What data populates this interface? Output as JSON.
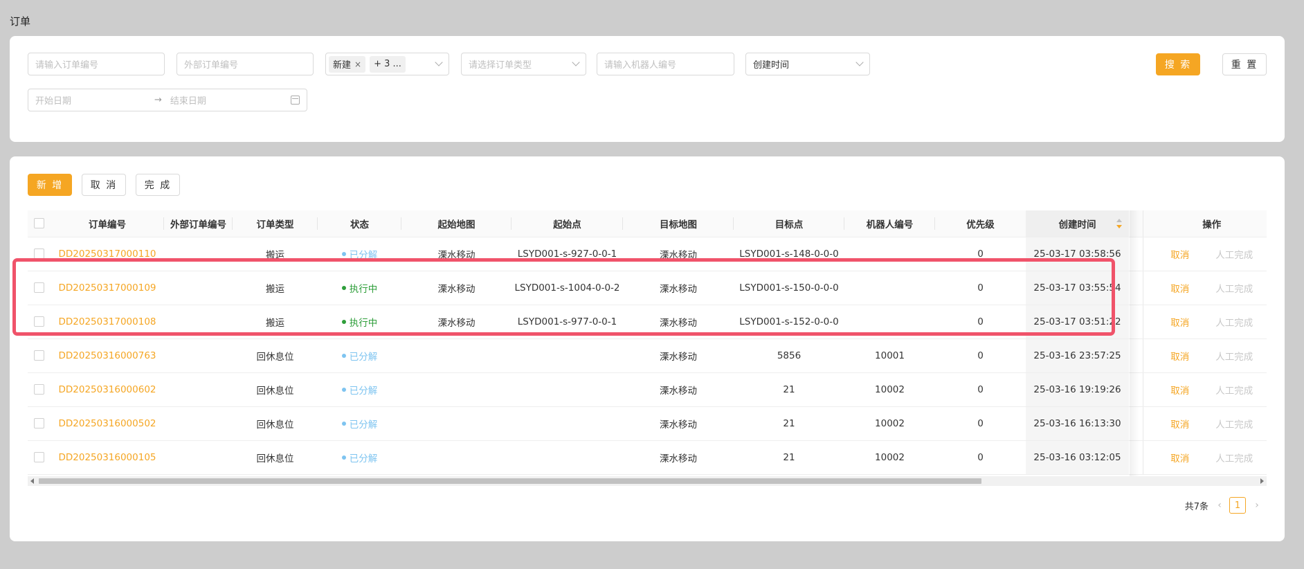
{
  "page": {
    "title": "订单"
  },
  "filters": {
    "order_no_placeholder": "请输入订单编号",
    "external_no_placeholder": "外部订单编号",
    "status_tags": [
      "新建",
      "+ 3 ..."
    ],
    "order_type_placeholder": "请选择订单类型",
    "robot_no_placeholder": "请输入机器人编号",
    "sort_field_value": "创建时间",
    "start_date_placeholder": "开始日期",
    "date_separator": "→",
    "end_date_placeholder": "结束日期",
    "search_label": "搜 索",
    "reset_label": "重 置"
  },
  "toolbar": {
    "add_label": "新 增",
    "cancel_label": "取 消",
    "complete_label": "完 成"
  },
  "table": {
    "columns": [
      "订单编号",
      "外部订单编号",
      "订单类型",
      "状态",
      "起始地图",
      "起始点",
      "目标地图",
      "目标点",
      "机器人编号",
      "优先级",
      "创建时间",
      "操作"
    ],
    "rows": [
      {
        "order_no": "DD20250317000110",
        "external_no": "",
        "type": "搬运",
        "status": "已分解",
        "start_map": "溧水移动",
        "start_point": "LSYD001-s-927-0-0-1",
        "target_map": "溧水移动",
        "target_point": "LSYD001-s-148-0-0-0",
        "robot_no": "",
        "priority": "0",
        "created": "25-03-17 03:58:56",
        "act_cancel": "取消",
        "act_done": "人工完成"
      },
      {
        "order_no": "DD20250317000109",
        "external_no": "",
        "type": "搬运",
        "status": "执行中",
        "start_map": "溧水移动",
        "start_point": "LSYD001-s-1004-0-0-2",
        "target_map": "溧水移动",
        "target_point": "LSYD001-s-150-0-0-0",
        "robot_no": "",
        "priority": "0",
        "created": "25-03-17 03:55:54",
        "act_cancel": "取消",
        "act_done": "人工完成"
      },
      {
        "order_no": "DD20250317000108",
        "external_no": "",
        "type": "搬运",
        "status": "执行中",
        "start_map": "溧水移动",
        "start_point": "LSYD001-s-977-0-0-1",
        "target_map": "溧水移动",
        "target_point": "LSYD001-s-152-0-0-0",
        "robot_no": "",
        "priority": "0",
        "created": "25-03-17 03:51:22",
        "act_cancel": "取消",
        "act_done": "人工完成"
      },
      {
        "order_no": "DD20250316000763",
        "external_no": "",
        "type": "回休息位",
        "status": "已分解",
        "start_map": "",
        "start_point": "",
        "target_map": "溧水移动",
        "target_point": "5856",
        "robot_no": "10001",
        "priority": "0",
        "created": "25-03-16 23:57:25",
        "act_cancel": "取消",
        "act_done": "人工完成"
      },
      {
        "order_no": "DD20250316000602",
        "external_no": "",
        "type": "回休息位",
        "status": "已分解",
        "start_map": "",
        "start_point": "",
        "target_map": "溧水移动",
        "target_point": "21",
        "robot_no": "10002",
        "priority": "0",
        "created": "25-03-16 19:19:26",
        "act_cancel": "取消",
        "act_done": "人工完成"
      },
      {
        "order_no": "DD20250316000502",
        "external_no": "",
        "type": "回休息位",
        "status": "已分解",
        "start_map": "",
        "start_point": "",
        "target_map": "溧水移动",
        "target_point": "21",
        "robot_no": "10002",
        "priority": "0",
        "created": "25-03-16 16:13:30",
        "act_cancel": "取消",
        "act_done": "人工完成"
      },
      {
        "order_no": "DD20250316000105",
        "external_no": "",
        "type": "回休息位",
        "status": "已分解",
        "start_map": "",
        "start_point": "",
        "target_map": "溧水移动",
        "target_point": "21",
        "robot_no": "10002",
        "priority": "0",
        "created": "25-03-16 03:12:05",
        "act_cancel": "取消",
        "act_done": "人工完成"
      }
    ]
  },
  "status_colors": {
    "已分解": "#7ec4f0",
    "执行中": "#2e9e3a"
  },
  "colors": {
    "accent": "#f5a623",
    "highlight": "#f0536a"
  },
  "pagination": {
    "total_label": "共7条",
    "current_page": "1",
    "prev_icon": "‹",
    "next_icon": "›"
  }
}
